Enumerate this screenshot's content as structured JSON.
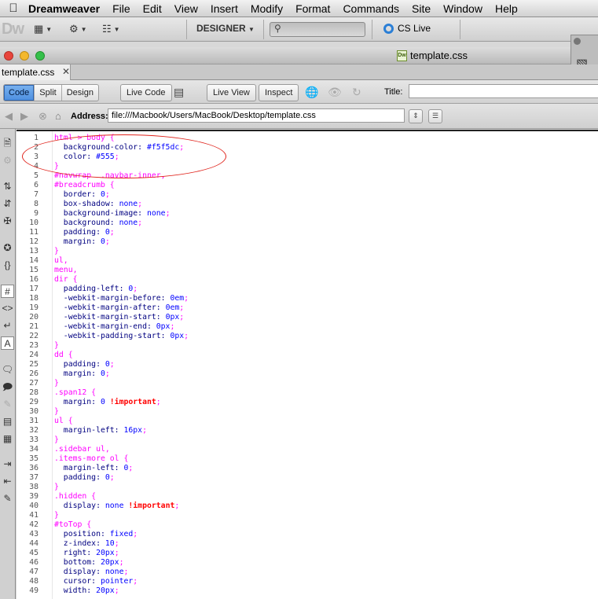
{
  "menubar": {
    "apple_icon": "apple-icon",
    "app_name": "Dreamweaver",
    "items": [
      "File",
      "Edit",
      "View",
      "Insert",
      "Modify",
      "Format",
      "Commands",
      "Site",
      "Window",
      "Help"
    ]
  },
  "appbar": {
    "logo": "Dw",
    "workspace_label": "DESIGNER",
    "search_placeholder": "",
    "cs_live_label": "CS Live"
  },
  "document": {
    "window_title": "template.css",
    "tab_label": "template.css",
    "toolbar": {
      "views": [
        "Code",
        "Split",
        "Design"
      ],
      "active_view": "Code",
      "live_code_label": "Live Code",
      "live_view_label": "Live View",
      "inspect_label": "Inspect",
      "title_label": "Title:",
      "title_value": ""
    },
    "address": {
      "label": "Address:",
      "value": "file:///Macbook/Users/MacBook/Desktop/template.css"
    }
  },
  "colors": {
    "selector": "#ff00ff",
    "property": "#000080",
    "value": "#0000ff",
    "important": "#ff0000",
    "annotation": "#e0241c",
    "active_view": "#4d8fe0"
  },
  "code_lines": [
    {
      "n": "1",
      "parts": [
        [
          "sel",
          "html > body {"
        ]
      ]
    },
    {
      "n": "2",
      "parts": [
        [
          "prop",
          "  background-color: "
        ],
        [
          "val",
          "#f5f5dc"
        ],
        [
          "pun",
          ";"
        ]
      ]
    },
    {
      "n": "3",
      "parts": [
        [
          "prop",
          "  color: "
        ],
        [
          "val",
          "#555"
        ],
        [
          "pun",
          ";"
        ]
      ]
    },
    {
      "n": "4",
      "parts": [
        [
          "sel",
          "}"
        ]
      ]
    },
    {
      "n": "5",
      "parts": [
        [
          "sel",
          "#navwrap  .navbar-inner,"
        ]
      ]
    },
    {
      "n": "6",
      "parts": [
        [
          "sel",
          "#breadcrumb {"
        ]
      ]
    },
    {
      "n": "7",
      "parts": [
        [
          "prop",
          "  border: "
        ],
        [
          "val",
          "0"
        ],
        [
          "pun",
          ";"
        ]
      ]
    },
    {
      "n": "8",
      "parts": [
        [
          "prop",
          "  box-shadow: "
        ],
        [
          "val",
          "none"
        ],
        [
          "pun",
          ";"
        ]
      ]
    },
    {
      "n": "9",
      "parts": [
        [
          "prop",
          "  background-image: "
        ],
        [
          "val",
          "none"
        ],
        [
          "pun",
          ";"
        ]
      ]
    },
    {
      "n": "10",
      "parts": [
        [
          "prop",
          "  background: "
        ],
        [
          "val",
          "none"
        ],
        [
          "pun",
          ";"
        ]
      ]
    },
    {
      "n": "11",
      "parts": [
        [
          "prop",
          "  padding: "
        ],
        [
          "val",
          "0"
        ],
        [
          "pun",
          ";"
        ]
      ]
    },
    {
      "n": "12",
      "parts": [
        [
          "prop",
          "  margin: "
        ],
        [
          "val",
          "0"
        ],
        [
          "pun",
          ";"
        ]
      ]
    },
    {
      "n": "13",
      "parts": [
        [
          "sel",
          "}"
        ]
      ]
    },
    {
      "n": "14",
      "parts": [
        [
          "sel",
          "ul,"
        ]
      ]
    },
    {
      "n": "15",
      "parts": [
        [
          "sel",
          "menu,"
        ]
      ]
    },
    {
      "n": "16",
      "parts": [
        [
          "sel",
          "dir {"
        ]
      ]
    },
    {
      "n": "17",
      "parts": [
        [
          "prop",
          "  padding-left: "
        ],
        [
          "val",
          "0"
        ],
        [
          "pun",
          ";"
        ]
      ]
    },
    {
      "n": "18",
      "parts": [
        [
          "prop",
          "  -webkit-margin-before: "
        ],
        [
          "val",
          "0em"
        ],
        [
          "pun",
          ";"
        ]
      ]
    },
    {
      "n": "19",
      "parts": [
        [
          "prop",
          "  -webkit-margin-after: "
        ],
        [
          "val",
          "0em"
        ],
        [
          "pun",
          ";"
        ]
      ]
    },
    {
      "n": "20",
      "parts": [
        [
          "prop",
          "  -webkit-margin-start: "
        ],
        [
          "val",
          "0px"
        ],
        [
          "pun",
          ";"
        ]
      ]
    },
    {
      "n": "21",
      "parts": [
        [
          "prop",
          "  -webkit-margin-end: "
        ],
        [
          "val",
          "0px"
        ],
        [
          "pun",
          ";"
        ]
      ]
    },
    {
      "n": "22",
      "parts": [
        [
          "prop",
          "  -webkit-padding-start: "
        ],
        [
          "val",
          "0px"
        ],
        [
          "pun",
          ";"
        ]
      ]
    },
    {
      "n": "23",
      "parts": [
        [
          "sel",
          "}"
        ]
      ]
    },
    {
      "n": "24",
      "parts": [
        [
          "sel",
          "dd {"
        ]
      ]
    },
    {
      "n": "25",
      "parts": [
        [
          "prop",
          "  padding: "
        ],
        [
          "val",
          "0"
        ],
        [
          "pun",
          ";"
        ]
      ]
    },
    {
      "n": "26",
      "parts": [
        [
          "prop",
          "  margin: "
        ],
        [
          "val",
          "0"
        ],
        [
          "pun",
          ";"
        ]
      ]
    },
    {
      "n": "27",
      "parts": [
        [
          "sel",
          "}"
        ]
      ]
    },
    {
      "n": "28",
      "parts": [
        [
          "sel",
          ".span12 {"
        ]
      ]
    },
    {
      "n": "29",
      "parts": [
        [
          "prop",
          "  margin: "
        ],
        [
          "val",
          "0 "
        ],
        [
          "imp",
          "!important"
        ],
        [
          "pun",
          ";"
        ]
      ]
    },
    {
      "n": "30",
      "parts": [
        [
          "sel",
          "}"
        ]
      ]
    },
    {
      "n": "31",
      "parts": [
        [
          "sel",
          "ul {"
        ]
      ]
    },
    {
      "n": "32",
      "parts": [
        [
          "prop",
          "  margin-left: "
        ],
        [
          "val",
          "16px"
        ],
        [
          "pun",
          ";"
        ]
      ]
    },
    {
      "n": "33",
      "parts": [
        [
          "sel",
          "}"
        ]
      ]
    },
    {
      "n": "34",
      "parts": [
        [
          "sel",
          ".sidebar ul,"
        ]
      ]
    },
    {
      "n": "35",
      "parts": [
        [
          "sel",
          ".items-more ol {"
        ]
      ]
    },
    {
      "n": "36",
      "parts": [
        [
          "prop",
          "  margin-left: "
        ],
        [
          "val",
          "0"
        ],
        [
          "pun",
          ";"
        ]
      ]
    },
    {
      "n": "37",
      "parts": [
        [
          "prop",
          "  padding: "
        ],
        [
          "val",
          "0"
        ],
        [
          "pun",
          ";"
        ]
      ]
    },
    {
      "n": "38",
      "parts": [
        [
          "sel",
          "}"
        ]
      ]
    },
    {
      "n": "39",
      "parts": [
        [
          "sel",
          ".hidden {"
        ]
      ]
    },
    {
      "n": "40",
      "parts": [
        [
          "prop",
          "  display: "
        ],
        [
          "val",
          "none "
        ],
        [
          "imp",
          "!important"
        ],
        [
          "pun",
          ";"
        ]
      ]
    },
    {
      "n": "41",
      "parts": [
        [
          "sel",
          "}"
        ]
      ]
    },
    {
      "n": "42",
      "parts": [
        [
          "sel",
          "#toTop {"
        ]
      ]
    },
    {
      "n": "43",
      "parts": [
        [
          "prop",
          "  position: "
        ],
        [
          "val",
          "fixed"
        ],
        [
          "pun",
          ";"
        ]
      ]
    },
    {
      "n": "44",
      "parts": [
        [
          "prop",
          "  z-index: "
        ],
        [
          "val",
          "10"
        ],
        [
          "pun",
          ";"
        ]
      ]
    },
    {
      "n": "45",
      "parts": [
        [
          "prop",
          "  right: "
        ],
        [
          "val",
          "20px"
        ],
        [
          "pun",
          ";"
        ]
      ]
    },
    {
      "n": "46",
      "parts": [
        [
          "prop",
          "  bottom: "
        ],
        [
          "val",
          "20px"
        ],
        [
          "pun",
          ";"
        ]
      ]
    },
    {
      "n": "47",
      "parts": [
        [
          "prop",
          "  display: "
        ],
        [
          "val",
          "none"
        ],
        [
          "pun",
          ";"
        ]
      ]
    },
    {
      "n": "48",
      "parts": [
        [
          "prop",
          "  cursor: "
        ],
        [
          "val",
          "pointer"
        ],
        [
          "pun",
          ";"
        ]
      ]
    },
    {
      "n": "49",
      "parts": [
        [
          "prop",
          "  width: "
        ],
        [
          "val",
          "20px"
        ],
        [
          "pun",
          ";"
        ]
      ]
    }
  ]
}
